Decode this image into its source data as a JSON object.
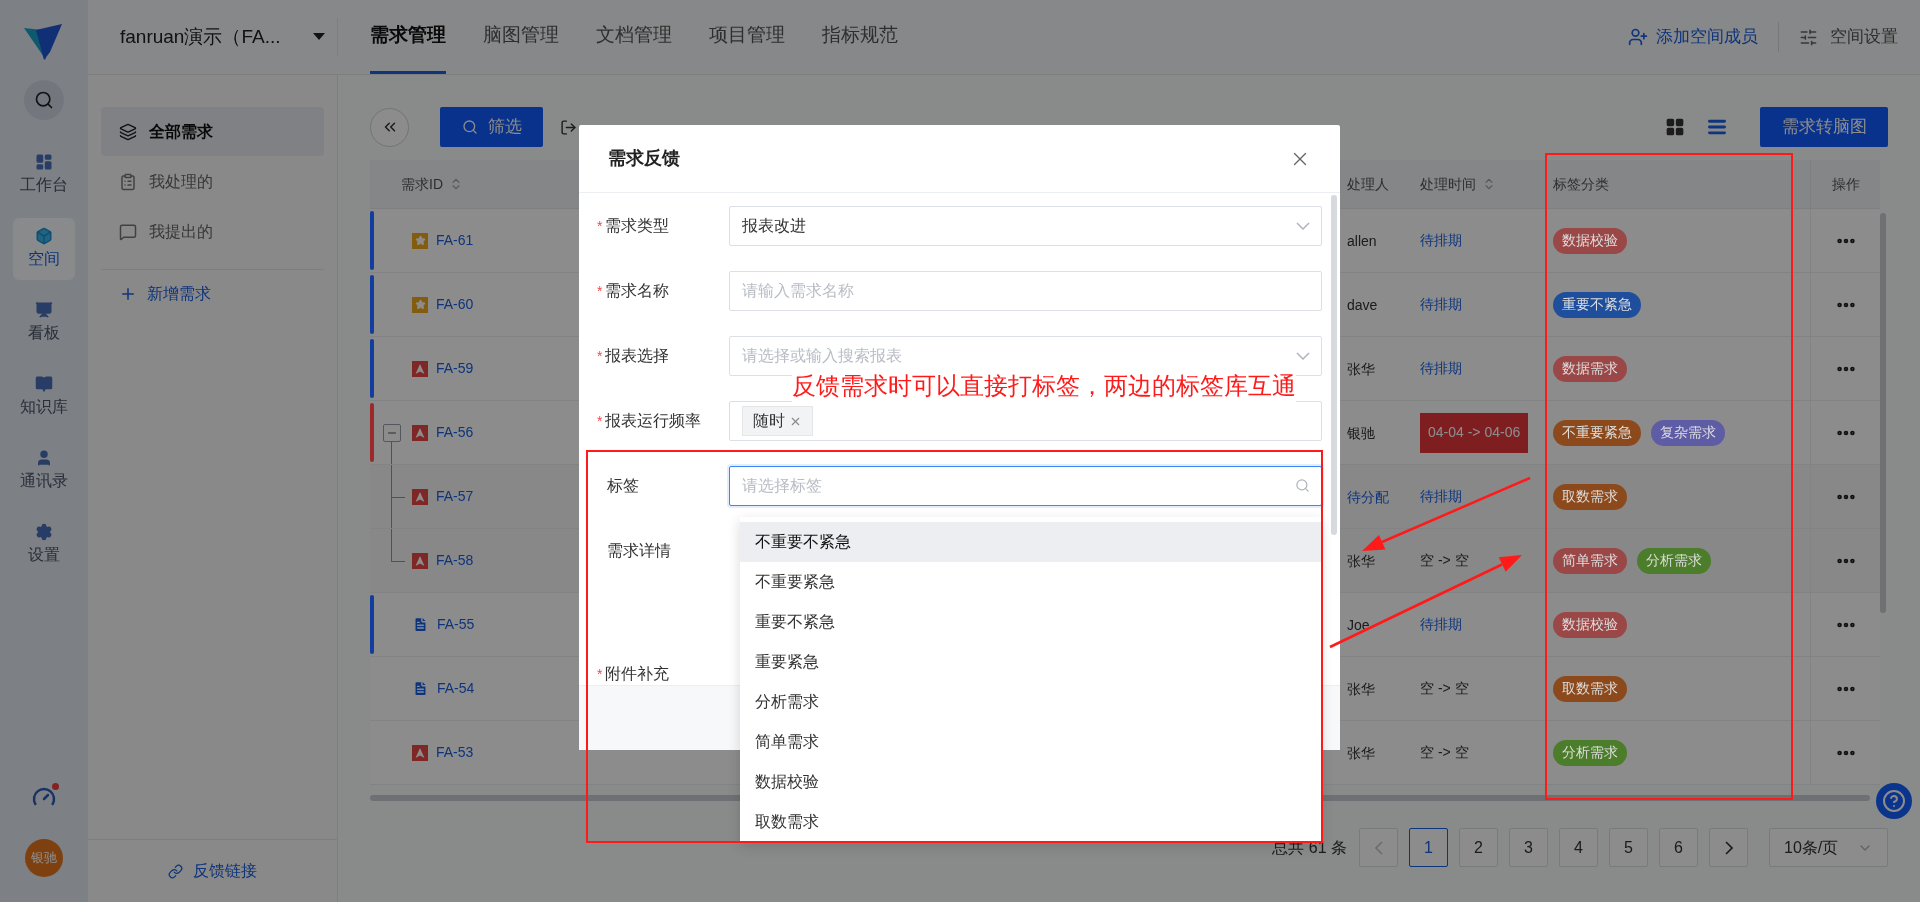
{
  "rail": {
    "items": [
      {
        "label": "工作台",
        "selected": false
      },
      {
        "label": "空间",
        "selected": true
      },
      {
        "label": "看板",
        "selected": false
      },
      {
        "label": "知识库",
        "selected": false
      },
      {
        "label": "通讯录",
        "selected": false
      },
      {
        "label": "设置",
        "selected": false
      }
    ],
    "notification": true,
    "avatar": "银驰"
  },
  "topbar": {
    "space": "fanruan演示（FA...",
    "tabs": [
      {
        "label": "需求管理",
        "selected": true
      },
      {
        "label": "脑图管理",
        "selected": false
      },
      {
        "label": "文档管理",
        "selected": false
      },
      {
        "label": "项目管理",
        "selected": false
      },
      {
        "label": "指标规范",
        "selected": false
      }
    ],
    "actions": [
      "添加空间成员",
      "空间设置"
    ]
  },
  "sidebar": {
    "items": [
      {
        "label": "全部需求",
        "selected": true
      },
      {
        "label": "我处理的",
        "selected": false
      },
      {
        "label": "我提出的",
        "selected": false
      }
    ],
    "add": "新增需求",
    "footer": "反馈链接"
  },
  "toolbar": {
    "filter": "筛选",
    "convert": "需求转脑图",
    "views": [
      {
        "kind": "grid",
        "selected": false
      },
      {
        "kind": "list",
        "selected": true
      }
    ]
  },
  "table": {
    "columns": [
      {
        "label": "需求ID",
        "sortable": true
      },
      {
        "label": "处理人",
        "sortable": false
      },
      {
        "label": "处理时间",
        "sortable": true
      },
      {
        "label": "标签分类",
        "sortable": false
      },
      {
        "label": "操作",
        "sortable": false
      }
    ],
    "rows": [
      {
        "id": "FA-61",
        "kind": "star",
        "marker": {
          "color": "#123d9e"
        },
        "assignee": "allen",
        "time": {
          "text": "待排期",
          "kind": "link"
        },
        "tags": [
          {
            "label": "数据校验",
            "color": "#9a4747"
          }
        ]
      },
      {
        "id": "FA-60",
        "kind": "star",
        "marker": {
          "color": "#123d9e"
        },
        "assignee": "dave",
        "time": {
          "text": "待排期",
          "kind": "link"
        },
        "tags": [
          {
            "label": "重要不紧急",
            "color": "#1f4f9c"
          }
        ]
      },
      {
        "id": "FA-59",
        "kind": "alert",
        "marker": {
          "color": "#123d9e"
        },
        "assignee": "张华",
        "time": {
          "text": "待排期",
          "kind": "link"
        },
        "tags": [
          {
            "label": "数据需求",
            "color": "#9a4747"
          }
        ]
      },
      {
        "id": "FA-56",
        "kind": "alert",
        "marker": {
          "color": "#9c2a2a"
        },
        "expanded": true,
        "assignee": "银驰",
        "time": {
          "text": "04-04 -> 04-06",
          "kind": "overdue"
        },
        "tags": [
          {
            "label": "不重要紧急",
            "color": "#8c4a1c"
          },
          {
            "label": "复杂需求",
            "color": "#5f5ca6"
          }
        ],
        "children": [
          {
            "id": "FA-57",
            "kind": "alert",
            "assignee": "待分配",
            "assignee_pending": true,
            "time": {
              "text": "待排期",
              "kind": "link"
            },
            "tags": [
              {
                "label": "取数需求",
                "color": "#8c4a1c"
              }
            ]
          },
          {
            "id": "FA-58",
            "kind": "alert",
            "assignee": "张华",
            "assignee_pending": false,
            "time": {
              "text": "空 -> 空",
              "kind": "plain"
            },
            "tags": [
              {
                "label": "简单需求",
                "color": "#9a4747"
              },
              {
                "label": "分析需求",
                "color": "#4b7d2a"
              }
            ]
          }
        ]
      },
      {
        "id": "FA-55",
        "kind": "document",
        "marker": {
          "color": "#123d9e"
        },
        "assignee": "Joe",
        "time": {
          "text": "待排期",
          "kind": "link"
        },
        "tags": [
          {
            "label": "数据校验",
            "color": "#9a4747"
          }
        ]
      },
      {
        "id": "FA-54",
        "kind": "document",
        "assignee": "张华",
        "time": {
          "text": "空 -> 空",
          "kind": "plain"
        },
        "tags": [
          {
            "label": "取数需求",
            "color": "#8c4a1c"
          }
        ]
      },
      {
        "id": "FA-53",
        "kind": "alert",
        "assignee": "张华",
        "time": {
          "text": "空 -> 空",
          "kind": "plain"
        },
        "tags": [
          {
            "label": "分析需求",
            "color": "#4b7d2a"
          }
        ]
      }
    ]
  },
  "pagination": {
    "total": "总共 61 条",
    "prev_disabled": true,
    "pages": [
      {
        "label": "1",
        "selected": true
      },
      {
        "label": "2",
        "selected": false
      },
      {
        "label": "3",
        "selected": false
      },
      {
        "label": "4",
        "selected": false
      },
      {
        "label": "5",
        "selected": false
      },
      {
        "label": "6",
        "selected": false
      }
    ],
    "size": "10条/页"
  },
  "modal": {
    "title": "需求反馈",
    "fields": [
      {
        "label": "需求类型",
        "required_mark": "*",
        "kind": "select",
        "value": "报表改进"
      },
      {
        "label": "需求名称",
        "required_mark": "*",
        "kind": "input",
        "placeholder": "请输入需求名称"
      },
      {
        "label": "报表选择",
        "required_mark": "*",
        "kind": "select",
        "placeholder": "请选择或输入搜索报表"
      },
      {
        "label": "报表运行频率",
        "required_mark": "*",
        "kind": "tags",
        "tags": [
          "随时"
        ]
      },
      {
        "label": "标签",
        "kind": "search",
        "placeholder": "请选择标签",
        "focused": true
      },
      {
        "label": "需求详情",
        "kind": "editor"
      },
      {
        "label": "附件补充",
        "required_mark": "*",
        "kind": "upload"
      }
    ],
    "dropdown": [
      {
        "label": "不重要不紧急",
        "highlighted": true
      },
      {
        "label": "不重要紧急",
        "highlighted": false
      },
      {
        "label": "重要不紧急",
        "highlighted": false
      },
      {
        "label": "重要紧急",
        "highlighted": false
      },
      {
        "label": "分析需求",
        "highlighted": false
      },
      {
        "label": "简单需求",
        "highlighted": false
      },
      {
        "label": "数据校验",
        "highlighted": false
      },
      {
        "label": "取数需求",
        "highlighted": false
      }
    ]
  },
  "annotation": {
    "note": "反馈需求时可以直接打标签，两边的标签库互通"
  }
}
